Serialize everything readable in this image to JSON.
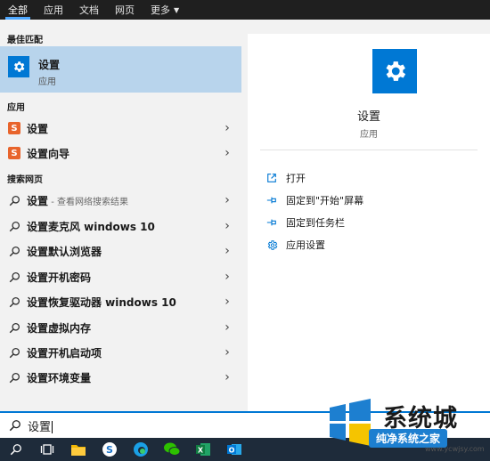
{
  "tabs": [
    {
      "label": "全部",
      "active": true
    },
    {
      "label": "应用"
    },
    {
      "label": "文档"
    },
    {
      "label": "网页"
    },
    {
      "label": "更多"
    }
  ],
  "left": {
    "best_match_header": "最佳匹配",
    "best_match": {
      "title": "设置",
      "subtitle": "应用",
      "icon": "gear-icon"
    },
    "apps_header": "应用",
    "apps": [
      {
        "label": "设置",
        "icon": "app-icon"
      },
      {
        "label": "设置向导",
        "icon": "app-icon"
      }
    ],
    "web_header": "搜索网页",
    "web_results": [
      {
        "label": "设置",
        "suffix": " - 查看网络搜索结果"
      },
      {
        "label": "设置麦克风 windows 10",
        "suffix": ""
      },
      {
        "label": "设置默认浏览器",
        "suffix": ""
      },
      {
        "label": "设置开机密码",
        "suffix": ""
      },
      {
        "label": "设置恢复驱动器 windows 10",
        "suffix": ""
      },
      {
        "label": "设置虚拟内存",
        "suffix": ""
      },
      {
        "label": "设置开机启动项",
        "suffix": ""
      },
      {
        "label": "设置环境变量",
        "suffix": ""
      }
    ]
  },
  "preview": {
    "title": "设置",
    "subtitle": "应用",
    "actions": [
      {
        "label": "打开",
        "icon": "open-icon"
      },
      {
        "label": "固定到\"开始\"屏幕",
        "icon": "pin-icon"
      },
      {
        "label": "固定到任务栏",
        "icon": "pin-icon"
      },
      {
        "label": "应用设置",
        "icon": "gear-icon"
      }
    ]
  },
  "search": {
    "value": "设置"
  },
  "taskbar": {
    "items": [
      "search-icon",
      "task-view-icon",
      "file-explorer-icon",
      "sogou-icon",
      "edge-icon",
      "wechat-icon",
      "excel-icon",
      "outlook-icon"
    ]
  },
  "watermark": {
    "brand": "系统城",
    "badge": "纯净系统之家",
    "url": "www.ycwjsy.com"
  },
  "colors": {
    "accent": "#0078d4",
    "selected_row": "#b8d4ec",
    "taskbar": "#1e2b3a",
    "tabbar": "#1f1f1f"
  }
}
